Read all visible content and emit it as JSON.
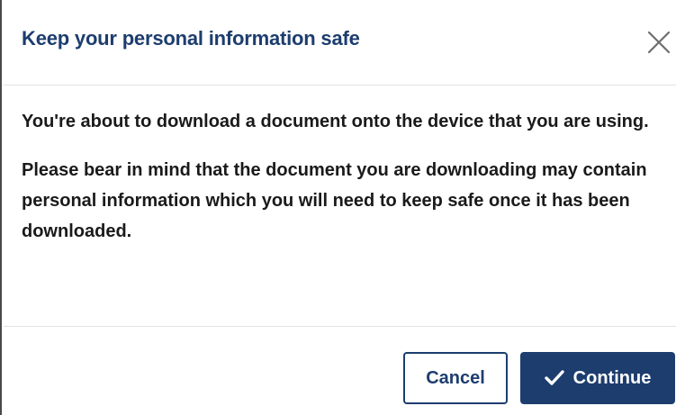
{
  "dialog": {
    "title": "Keep your personal information safe",
    "close_icon": "close-icon",
    "paragraphs": [
      "You're about to download a document onto the device that you are using.",
      "Please bear in mind that the document you are downloading may contain personal information which you will need to keep safe once it has been downloaded."
    ],
    "buttons": {
      "cancel_label": "Cancel",
      "continue_label": "Continue",
      "continue_icon": "check-icon"
    }
  },
  "colors": {
    "primary": "#1d3d6e",
    "text": "#1a1a1a",
    "divider": "#e2e2e2",
    "background": "#ffffff"
  }
}
